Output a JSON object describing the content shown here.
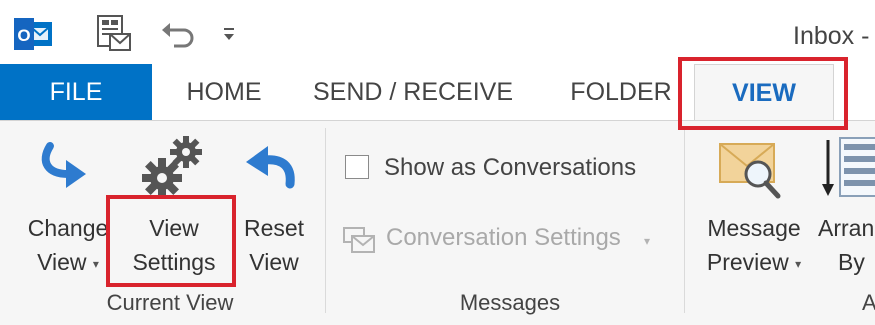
{
  "window": {
    "title": "Inbox -"
  },
  "tabs": [
    {
      "label": "FILE"
    },
    {
      "label": "HOME"
    },
    {
      "label": "SEND / RECEIVE"
    },
    {
      "label": "FOLDER"
    },
    {
      "label": "VIEW"
    }
  ],
  "active_tab": "VIEW",
  "ribbon": {
    "current_view": {
      "group_label": "Current View",
      "change_view": {
        "line1": "Change",
        "line2": "View"
      },
      "view_settings": {
        "line1": "View",
        "line2": "Settings"
      },
      "reset_view": {
        "line1": "Reset",
        "line2": "View"
      }
    },
    "messages": {
      "group_label": "Messages",
      "show_as_conversations": {
        "label": "Show as Conversations",
        "checked": false
      },
      "conversation_settings": {
        "label": "Conversation Settings",
        "enabled": false
      }
    },
    "arrangement": {
      "message_preview": {
        "line1": "Message",
        "line2": "Preview"
      },
      "arrange_by": {
        "line1": "Arran",
        "line2": "By"
      },
      "group_label_fragment": "A"
    }
  },
  "icons": {
    "outlook": "outlook-icon",
    "new_items": "send-receive-icon",
    "undo": "undo-icon",
    "customize": "customize-qat-icon",
    "change_view": "change-view-icon",
    "view_settings": "gears-icon",
    "reset_view": "reset-icon",
    "conversation_settings": "conversation-icon",
    "message_preview": "envelope-magnifier-icon",
    "arrange_by": "arrange-icon"
  },
  "colors": {
    "file_tab": "#0072c6",
    "accent": "#1a6bbf",
    "highlight": "#d9232d",
    "ribbon_bg": "#f6f6f6"
  }
}
